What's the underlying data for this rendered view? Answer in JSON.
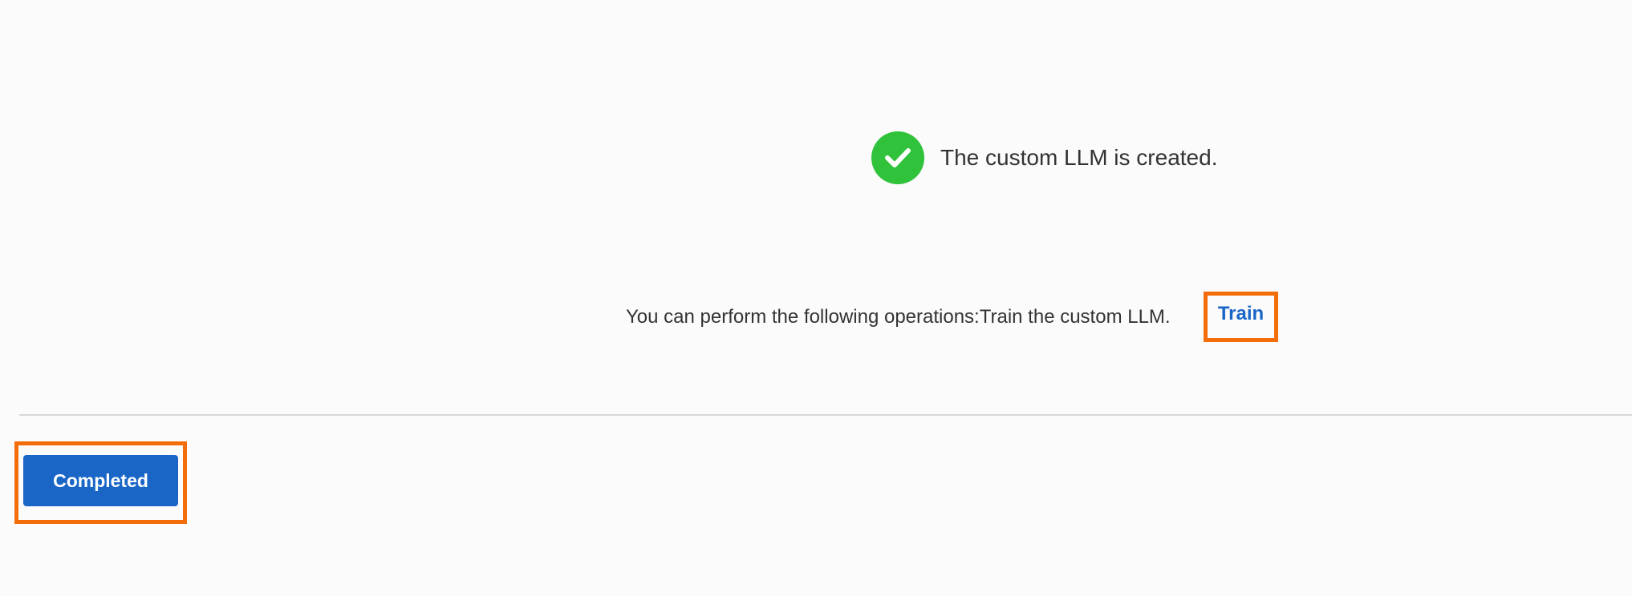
{
  "result": {
    "icon": "check-circle-icon",
    "message": "The custom LLM is created."
  },
  "operations": {
    "text": "You can perform the following operations:Train the custom LLM.",
    "link_label": "Train"
  },
  "footer": {
    "completed_label": "Completed"
  },
  "colors": {
    "success": "#2fc23a",
    "primary": "#1966c7",
    "highlight": "#f46d0b"
  }
}
